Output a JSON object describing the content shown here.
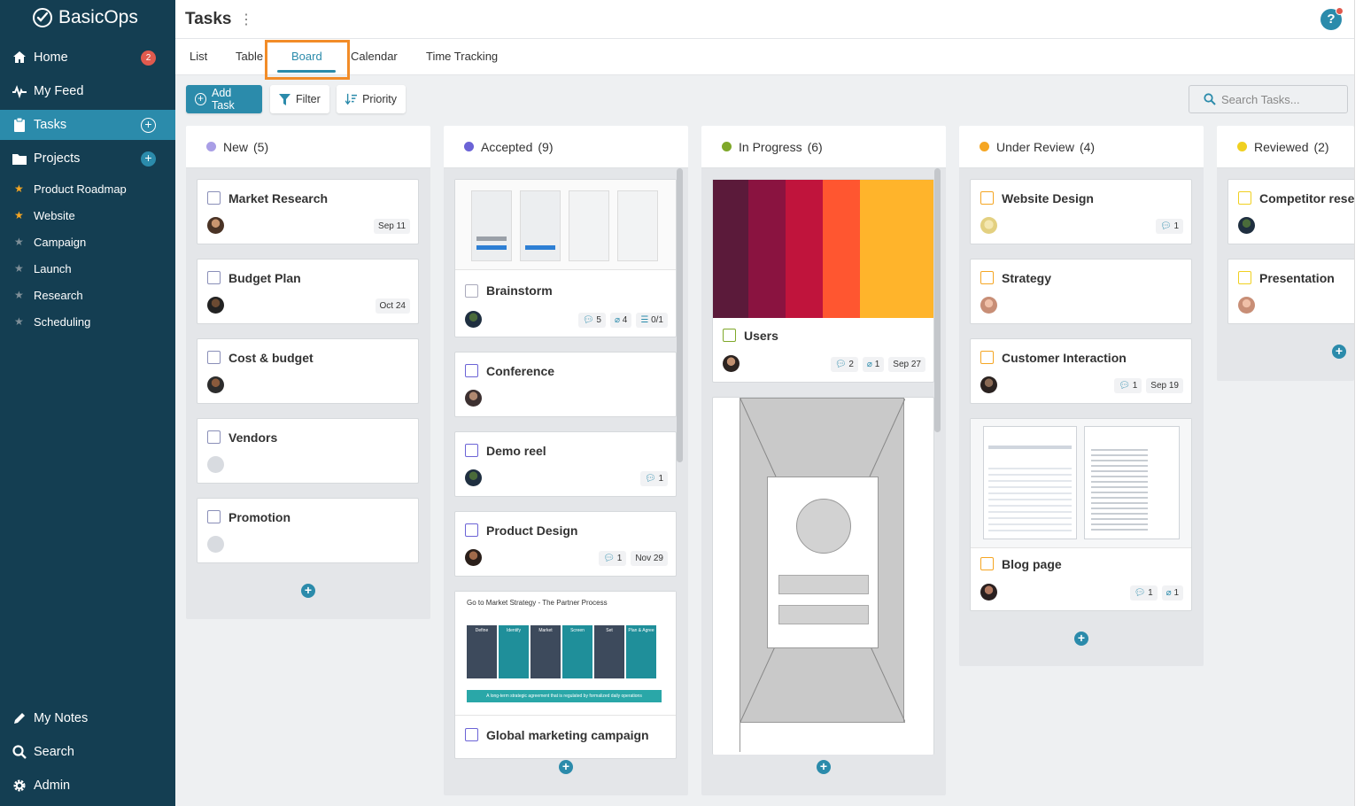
{
  "app": {
    "name": "BasicOps"
  },
  "sidebar": {
    "nav": [
      {
        "label": "Home",
        "icon": "home-icon",
        "badge": "2"
      },
      {
        "label": "My Feed",
        "icon": "pulse-icon"
      },
      {
        "label": "Tasks",
        "icon": "clipboard-icon",
        "active": true
      },
      {
        "label": "Projects",
        "icon": "folder-icon"
      }
    ],
    "projects": [
      {
        "label": "Product Roadmap",
        "starred": true
      },
      {
        "label": "Website",
        "starred": true
      },
      {
        "label": "Campaign",
        "starred": false
      },
      {
        "label": "Launch",
        "starred": false
      },
      {
        "label": "Research",
        "starred": false
      },
      {
        "label": "Scheduling",
        "starred": false
      }
    ],
    "bottom": [
      {
        "label": "My Notes",
        "icon": "pencil-icon"
      },
      {
        "label": "Search",
        "icon": "search-icon"
      },
      {
        "label": "Admin",
        "icon": "gear-icon"
      }
    ]
  },
  "header": {
    "title": "Tasks"
  },
  "tabs": [
    {
      "label": "List"
    },
    {
      "label": "Table"
    },
    {
      "label": "Board",
      "active": true
    },
    {
      "label": "Calendar"
    },
    {
      "label": "Time Tracking"
    }
  ],
  "toolbar": {
    "add_task": "Add Task",
    "filter": "Filter",
    "priority": "Priority",
    "search_placeholder": "Search Tasks..."
  },
  "colors": {
    "accent": "#2b8bab",
    "sidebar": "#143e52",
    "highlight": "#f28c28"
  },
  "columns": [
    {
      "name": "New",
      "count": "(5)",
      "color": "#a99ee6",
      "cards": [
        {
          "title": "Market Research",
          "date": "Sep 11"
        },
        {
          "title": "Budget Plan",
          "date": "Oct 24"
        },
        {
          "title": "Cost & budget"
        },
        {
          "title": "Vendors"
        },
        {
          "title": "Promotion"
        }
      ]
    },
    {
      "name": "Accepted",
      "count": "(9)",
      "color": "#6b63d6",
      "cards": [
        {
          "title": "Brainstorm",
          "comments": "5",
          "attachments": "4",
          "checklist": "0/1"
        },
        {
          "title": "Conference"
        },
        {
          "title": "Demo reel",
          "comments": "1"
        },
        {
          "title": "Product Design",
          "comments": "1",
          "date": "Nov 29"
        },
        {
          "title": "Global marketing campaign",
          "image_title": "Go to Market Strategy - The Partner Process",
          "stages": [
            "Define",
            "Identify",
            "Market",
            "Screen",
            "Set",
            "Plan & Agree"
          ],
          "footer": "A long-term strategic agreement that is regulated by formalized daily operations"
        }
      ]
    },
    {
      "name": "In Progress",
      "count": "(6)",
      "color": "#7fa82a",
      "cards": [
        {
          "title": "Users",
          "comments": "2",
          "attachments": "1",
          "date": "Sep 27"
        }
      ]
    },
    {
      "name": "Under Review",
      "count": "(4)",
      "color": "#f5a623",
      "cards": [
        {
          "title": "Website Design",
          "comments": "1"
        },
        {
          "title": "Strategy"
        },
        {
          "title": "Customer Interaction",
          "comments": "1",
          "date": "Sep 19"
        },
        {
          "title": "Blog page",
          "comments": "1",
          "attachments": "1"
        }
      ]
    },
    {
      "name": "Reviewed",
      "count": "(2)",
      "color": "#f0d020",
      "cards": [
        {
          "title": "Competitor research"
        },
        {
          "title": "Presentation"
        }
      ]
    }
  ]
}
